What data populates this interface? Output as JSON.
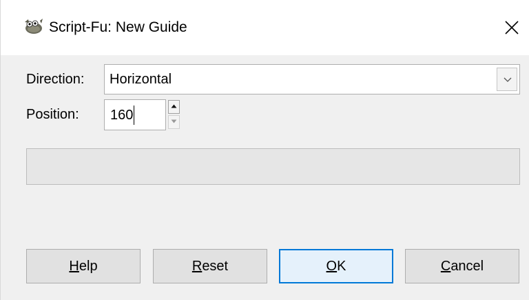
{
  "window": {
    "title": "Script-Fu: New Guide",
    "icon": "gimp-wilber-icon"
  },
  "form": {
    "direction": {
      "label": "Direction:",
      "value": "Horizontal"
    },
    "position": {
      "label": "Position:",
      "value": "160"
    }
  },
  "progress": {
    "value": 0
  },
  "buttons": {
    "help": {
      "mnemonic": "H",
      "rest": "elp"
    },
    "reset": {
      "mnemonic": "R",
      "rest": "eset"
    },
    "ok": {
      "mnemonic": "O",
      "rest": "K"
    },
    "cancel": {
      "mnemonic": "C",
      "rest": "ancel"
    }
  },
  "colors": {
    "default_button_border": "#0078d7",
    "dialog_background": "#f0f0f0"
  }
}
